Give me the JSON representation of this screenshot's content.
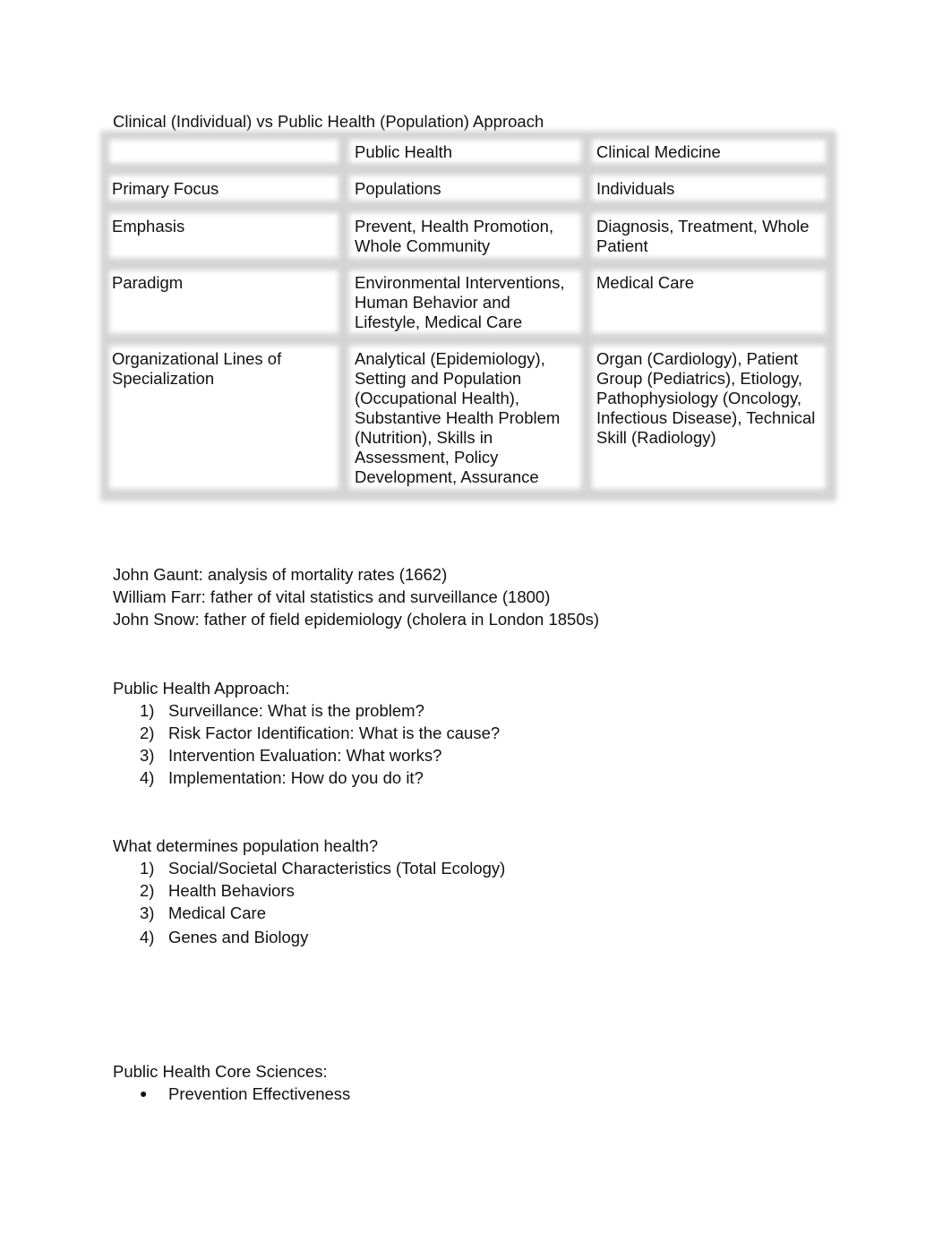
{
  "title": "Clinical (Individual) vs Public Health (Population) Approach",
  "table": {
    "headers": [
      "",
      "Public Health",
      "Clinical Medicine"
    ],
    "rows": [
      {
        "label": "Primary Focus",
        "public_health": "Populations",
        "clinical": "Individuals"
      },
      {
        "label": "Emphasis",
        "public_health": "Prevent, Health Promotion, Whole Community",
        "clinical": "Diagnosis, Treatment, Whole Patient"
      },
      {
        "label": "Paradigm",
        "public_health": "Environmental Interventions, Human Behavior and Lifestyle, Medical Care",
        "clinical": "Medical Care"
      },
      {
        "label": "Organizational Lines of Specialization",
        "public_health": "Analytical (Epidemiology), Setting and Population (Occupational Health), Substantive Health Problem (Nutrition), Skills in Assessment, Policy Development, Assurance",
        "clinical": "Organ (Cardiology), Patient Group (Pediatrics), Etiology, Pathophysiology (Oncology, Infectious Disease), Technical Skill (Radiology)"
      }
    ]
  },
  "history": [
    "John Gaunt: analysis of mortality rates (1662)",
    "William Farr: father of vital statistics and surveillance (1800)",
    "John Snow: father of field epidemiology (cholera in London 1850s)"
  ],
  "approach": {
    "heading": "Public Health Approach:",
    "items": [
      {
        "marker": "1)",
        "text": "Surveillance: What is the problem?"
      },
      {
        "marker": "2)",
        "text": "Risk Factor Identification: What is the cause?"
      },
      {
        "marker": "3)",
        "text": "Intervention Evaluation: What works?"
      },
      {
        "marker": "4)",
        "text": "Implementation: How do you do it?"
      }
    ]
  },
  "determinants": {
    "heading": "What determines population health?",
    "items": [
      {
        "marker": "1)",
        "text": "Social/Societal Characteristics (Total Ecology)"
      },
      {
        "marker": "2)",
        "text": "Health Behaviors"
      },
      {
        "marker": "3)",
        "text": "Medical Care"
      },
      {
        "marker": "4)",
        "text": "Genes and Biology"
      }
    ]
  },
  "core_sciences": {
    "heading": "Public Health Core Sciences:",
    "items": [
      {
        "marker": "●",
        "text": "Prevention Effectiveness"
      }
    ]
  }
}
